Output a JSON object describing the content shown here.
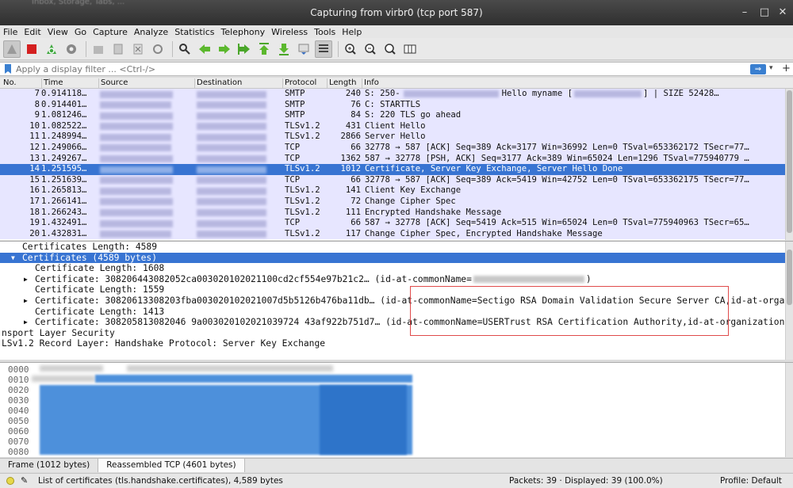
{
  "window": {
    "title": "Capturing from virbr0 (tcp port 587)",
    "bg_text": "Inbox, Storage, Tabs, ..."
  },
  "menu": [
    "File",
    "Edit",
    "View",
    "Go",
    "Capture",
    "Analyze",
    "Statistics",
    "Telephony",
    "Wireless",
    "Tools",
    "Help"
  ],
  "filter": {
    "placeholder": "Apply a display filter ... <Ctrl-/>"
  },
  "columns": [
    "No.",
    "Time",
    "Source",
    "Destination",
    "Protocol",
    "Length",
    "Info"
  ],
  "packets": [
    {
      "no": "7",
      "time": "0.914118…",
      "proto": "SMTP",
      "len": "240",
      "info": "S: 250-",
      "info2": "Hello myname [",
      "info3": "] | SIZE 52428…"
    },
    {
      "no": "8",
      "time": "0.914401…",
      "proto": "SMTP",
      "len": "76",
      "info": "C: STARTTLS"
    },
    {
      "no": "9",
      "time": "1.081246…",
      "proto": "SMTP",
      "len": "84",
      "info": "S: 220 TLS go ahead"
    },
    {
      "no": "10",
      "time": "1.082522…",
      "proto": "TLSv1.2",
      "len": "431",
      "info": "Client Hello"
    },
    {
      "no": "11",
      "time": "1.248994…",
      "proto": "TLSv1.2",
      "len": "2866",
      "info": "Server Hello"
    },
    {
      "no": "12",
      "time": "1.249066…",
      "proto": "TCP",
      "len": "66",
      "info": "32778 → 587 [ACK] Seq=389 Ack=3177 Win=36992 Len=0 TSval=653362172 TSecr=77…"
    },
    {
      "no": "13",
      "time": "1.249267…",
      "proto": "TCP",
      "len": "1362",
      "info": "587 → 32778 [PSH, ACK] Seq=3177 Ack=389 Win=65024 Len=1296 TSval=775940779 …"
    },
    {
      "no": "14",
      "time": "1.251595…",
      "proto": "TLSv1.2",
      "len": "1012",
      "info": "Certificate, Server Key Exchange, Server Hello Done",
      "selected": true
    },
    {
      "no": "15",
      "time": "1.251639…",
      "proto": "TCP",
      "len": "66",
      "info": "32778 → 587 [ACK] Seq=389 Ack=5419 Win=42752 Len=0 TSval=653362175 TSecr=77…"
    },
    {
      "no": "16",
      "time": "1.265813…",
      "proto": "TLSv1.2",
      "len": "141",
      "info": "Client Key Exchange"
    },
    {
      "no": "17",
      "time": "1.266141…",
      "proto": "TLSv1.2",
      "len": "72",
      "info": "Change Cipher Spec"
    },
    {
      "no": "18",
      "time": "1.266243…",
      "proto": "TLSv1.2",
      "len": "111",
      "info": "Encrypted Handshake Message"
    },
    {
      "no": "19",
      "time": "1.432491…",
      "proto": "TCP",
      "len": "66",
      "info": "587 → 32778 [ACK] Seq=5419 Ack=515 Win=65024 Len=0 TSval=775940963 TSecr=65…"
    },
    {
      "no": "20",
      "time": "1.432831…",
      "proto": "TLSv1.2",
      "len": "117",
      "info": "Change Cipher Spec, Encrypted Handshake Message"
    }
  ],
  "tree": [
    {
      "indent": 28,
      "arrow": "",
      "text": "Certificates Length: 4589"
    },
    {
      "indent": 28,
      "arrow": "▼",
      "text": "Certificates (4589 bytes)",
      "selected": true
    },
    {
      "indent": 44,
      "arrow": "",
      "text": "Certificate Length: 1608"
    },
    {
      "indent": 44,
      "arrow": "▶",
      "text": "Certificate: 308206443082052ca003020102021100cd2cf554e97b21c2… (id-at-commonName=",
      "suffix": ")"
    },
    {
      "indent": 44,
      "arrow": "",
      "text": "Certificate Length: 1559"
    },
    {
      "indent": 44,
      "arrow": "▶",
      "text": "Certificate: 30820613308203fba003020102021007d5b5126b476ba11db… (id-at-commonName=Sectigo RSA Domain Validation Secure Server CA,id-at-orga"
    },
    {
      "indent": 44,
      "arrow": "",
      "text": "Certificate Length: 1413"
    },
    {
      "indent": 44,
      "arrow": "▶",
      "text": "Certificate: 308205813082046 9a003020102021039724 43af922b751d7… (id-at-commonName=USERTrust RSA Certification Authority,id-at-organizationN"
    },
    {
      "indent": 2,
      "arrow": "",
      "text": "nsport Layer Security"
    },
    {
      "indent": 2,
      "arrow": "",
      "text": "LSv1.2 Record Layer: Handshake Protocol: Server Key Exchange"
    }
  ],
  "hex_offsets": [
    "0000",
    "0010",
    "0020",
    "0030",
    "0040",
    "0050",
    "0060",
    "0070",
    "0080"
  ],
  "bottom_tabs": [
    "Frame (1012 bytes)",
    "Reassembled TCP (4601 bytes)"
  ],
  "status": {
    "text": "List of certificates (tls.handshake.certificates), 4,589 bytes",
    "packets": "Packets: 39 · Displayed: 39 (100.0%)",
    "profile": "Profile: Default"
  },
  "colors": {
    "selected": "#3874d2",
    "row_bg": "#e7e6ff",
    "highlight_box": "#e04b4b"
  }
}
